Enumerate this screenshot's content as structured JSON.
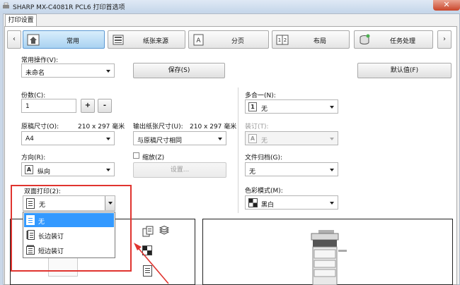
{
  "window": {
    "title": "SHARP MX-C4081R PCL6 打印首选项",
    "close_glyph": "✕"
  },
  "tab": {
    "label": "打印设置"
  },
  "nav": {
    "prev_glyph": "‹",
    "next_glyph": "›",
    "categories": [
      {
        "label": "常用",
        "icon": "home-icon"
      },
      {
        "label": "纸张来源",
        "icon": "paper-tray-icon"
      },
      {
        "label": "分页",
        "icon": "page-a-icon"
      },
      {
        "label": "布局",
        "icon": "layout-icon"
      },
      {
        "label": "任务处理",
        "icon": "job-stack-icon"
      }
    ]
  },
  "favorites": {
    "label": "常用操作(V):",
    "value": "未命名",
    "save_label": "保存(S)",
    "default_label": "默认值(F)"
  },
  "copies": {
    "label": "份数(C):",
    "value": "1",
    "plus": "+",
    "minus": "-"
  },
  "original_size": {
    "label": "原稿尺寸(O):",
    "dims": "210 x 297 毫米",
    "value": "A4"
  },
  "output_size": {
    "label": "输出纸张尺寸(U):",
    "dims": "210 x 297 毫米",
    "value": "与原稿尺寸相同"
  },
  "orientation": {
    "label": "方向(R):",
    "value": "纵向",
    "icon_glyph": "A"
  },
  "zoom": {
    "label": "缩放(Z)",
    "settings_label": "设置..."
  },
  "nup": {
    "label": "多合一(N):",
    "value": "无",
    "icon_glyph": "1"
  },
  "binding": {
    "label": "装订(T):",
    "value": "无",
    "icon_glyph": "A"
  },
  "filing": {
    "label": "文件归档(G):",
    "value": "无"
  },
  "color_mode": {
    "label": "色彩模式(M):",
    "value": "黑白"
  },
  "duplex": {
    "label": "双面打印(2):",
    "value": "无",
    "options": [
      "无",
      "长边装订",
      "短边装订"
    ]
  },
  "colors": {
    "accent": "#3399ff",
    "highlight_box": "#e0342f"
  }
}
